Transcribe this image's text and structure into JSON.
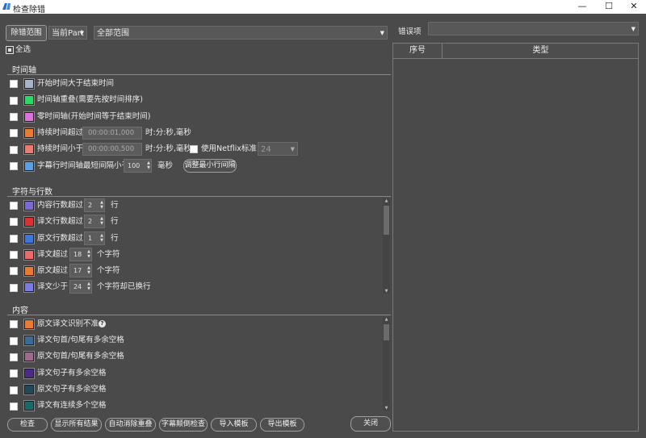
{
  "window": {
    "title": "检查除错",
    "minimize": "—",
    "maximize": "☐",
    "close": "✕"
  },
  "scope": {
    "button": "除错范围",
    "part_value": "当前Part",
    "range_value": "全部范围"
  },
  "errors": {
    "label": "错误项",
    "value": ""
  },
  "select_all": "全选",
  "timeline": {
    "header": "时间轴",
    "items": [
      {
        "label": "开始时间大于结束时间",
        "color": "#a8b4cc"
      },
      {
        "label": "时间轴重叠(需要先按时间排序)",
        "color": "#22dd66"
      },
      {
        "label": "零时间轴(开始时间等于结束时间)",
        "color": "#e070e0"
      },
      {
        "label": "持续时间超过",
        "color": "#ee7a2a",
        "value": "00:00:01,000",
        "unit": "时:分:秒,毫秒"
      },
      {
        "label": "持续时间小于",
        "color": "#ee7a70",
        "value": "00:00:00,500",
        "unit": "时:分:秒,毫秒",
        "netflix": "使用Netflix标准",
        "netflix_value": "24"
      },
      {
        "label": "字幕行时间轴最短间隔小于",
        "color": "#5aa0e8",
        "value": "100",
        "unit": "毫秒",
        "button": "调整最小行间隔"
      }
    ]
  },
  "lines": {
    "header": "字符与行数",
    "items": [
      {
        "label": "内容行数超过",
        "color": "#7a6ad8",
        "value": "2",
        "unit": "行"
      },
      {
        "label": "译文行数超过",
        "color": "#dd3030",
        "value": "2",
        "unit": "行"
      },
      {
        "label": "原文行数超过",
        "color": "#3a78e0",
        "value": "1",
        "unit": "行"
      },
      {
        "label": "译文超过",
        "color": "#ee6a6a",
        "value": "18",
        "unit": "个字符"
      },
      {
        "label": "原文超过",
        "color": "#ee7a2a",
        "value": "17",
        "unit": "个字符"
      },
      {
        "label": "译文少于",
        "color": "#7a7ae8",
        "value": "24",
        "unit": "个字符却已换行"
      }
    ]
  },
  "content": {
    "header": "内容",
    "help": "?",
    "items": [
      {
        "label": "原文译文识别不准",
        "color": "#ee7a2a"
      },
      {
        "label": "译文句首/句尾有多余空格",
        "color": "#3a6a98"
      },
      {
        "label": "原文句首/句尾有多余空格",
        "color": "#a06a90"
      },
      {
        "label": "译文句子有多余空格",
        "color": "#4a2a8a"
      },
      {
        "label": "原文句子有多余空格",
        "color": "#1e4a5a"
      },
      {
        "label": "译文有连续多个空格",
        "color": "#1a6a6a"
      }
    ]
  },
  "buttons": {
    "check": "检查",
    "show_all": "显示所有结果",
    "auto_dedupe": "自动消除重叠",
    "subtitle_check": "字幕颠倒检查",
    "import": "导入模板",
    "export": "导出模板",
    "close": "关闭"
  },
  "table": {
    "col_index": "序号",
    "col_type": "类型"
  },
  "icons": {
    "checkbox": "checkbox-icon",
    "dropdown": "chevron-down-icon",
    "spin": "spin-arrows-icon"
  }
}
